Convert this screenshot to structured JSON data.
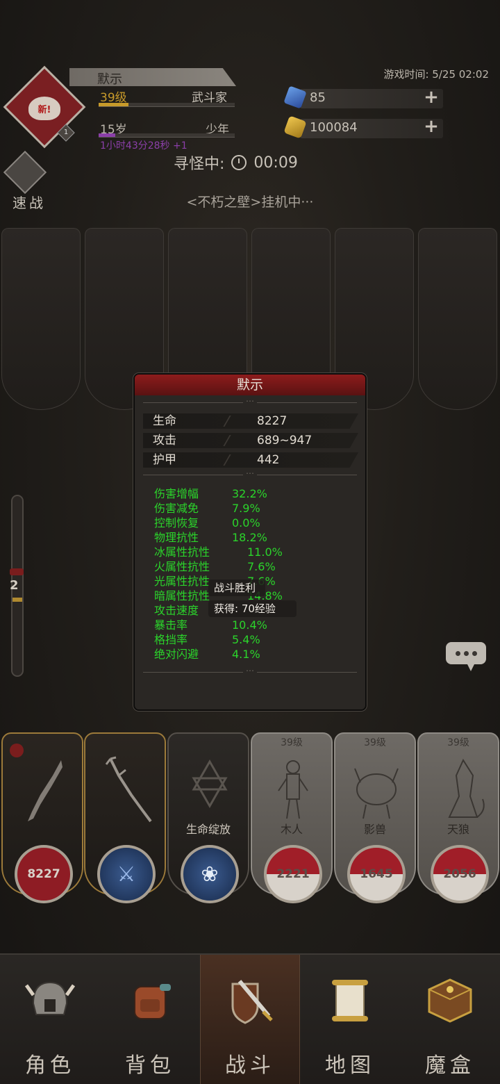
{
  "player": {
    "name": "默示",
    "level": "39级",
    "class": "武斗家",
    "age": "15岁",
    "stage": "少年",
    "timer": "1小时43分28秒 +1",
    "avatar_badge": "新!",
    "avatar_level": "1",
    "level_progress": 0.22,
    "age_progress": 0.12
  },
  "header": {
    "game_time": "游戏时间: 5/25 02:02",
    "gems": "85",
    "gold": "100084",
    "search_label": "寻怪中:",
    "search_timer": "00:09",
    "quick_battle": "速战",
    "idle_status": "<不朽之壁>挂机中···"
  },
  "gauge": {
    "value": "2"
  },
  "stats_panel": {
    "title": "默示",
    "base": [
      {
        "label": "生命",
        "value": "8227"
      },
      {
        "label": "攻击",
        "value": "689~947"
      },
      {
        "label": "护甲",
        "value": "442"
      }
    ],
    "extra": [
      {
        "label": "伤害增幅",
        "value": "32.2%"
      },
      {
        "label": "伤害减免",
        "value": "7.9%"
      },
      {
        "label": "控制恢复",
        "value": "0.0%"
      },
      {
        "label": "物理抗性",
        "value": "18.2%"
      },
      {
        "label": "冰属性抗性",
        "value": "11.0%"
      },
      {
        "label": "火属性抗性",
        "value": "7.6%"
      },
      {
        "label": "光属性抗性",
        "value": "7.6%"
      },
      {
        "label": "暗属性抗性",
        "value": "14.8%"
      },
      {
        "label": "攻击速度",
        "value": ""
      },
      {
        "label": "暴击率",
        "value": "10.4%"
      },
      {
        "label": "格挡率",
        "value": "5.4%"
      },
      {
        "label": "绝对闪避",
        "value": "4.1%"
      }
    ]
  },
  "toasts": {
    "victory": "战斗胜利",
    "reward": "获得: 70经验"
  },
  "cards": [
    {
      "type": "hero",
      "hp": "8227"
    },
    {
      "type": "weapon"
    },
    {
      "type": "skill",
      "name": "生命绽放"
    },
    {
      "type": "enemy",
      "level": "39级",
      "name": "木人",
      "hp": "2221",
      "hp_fraction": 0.5
    },
    {
      "type": "enemy",
      "level": "39级",
      "name": "影兽",
      "hp": "1645",
      "hp_fraction": 0.5
    },
    {
      "type": "enemy",
      "level": "39级",
      "name": "天狼",
      "hp": "2056",
      "hp_fraction": 0.5
    }
  ],
  "nav": [
    {
      "label": "角色",
      "icon": "helmet-icon"
    },
    {
      "label": "背包",
      "icon": "backpack-icon"
    },
    {
      "label": "战斗",
      "icon": "sword-shield-icon",
      "active": true
    },
    {
      "label": "地图",
      "icon": "scroll-map-icon"
    },
    {
      "label": "魔盒",
      "icon": "magic-box-icon"
    }
  ],
  "colors": {
    "accent_red": "#8d1c1c",
    "stat_green": "#2bd42b",
    "level_gold": "#c79a2a",
    "timer_purple": "#8b3fa8"
  }
}
